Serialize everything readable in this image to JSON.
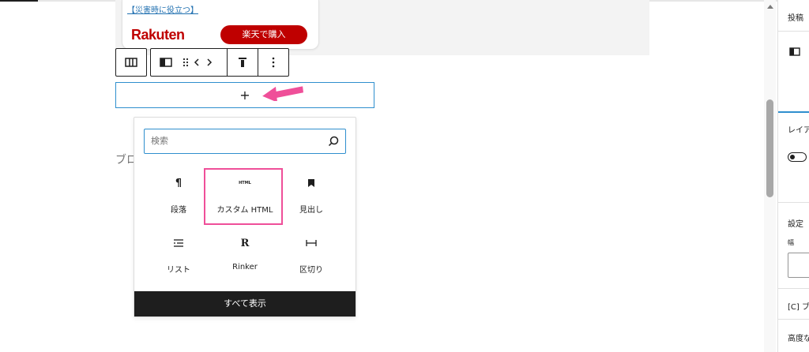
{
  "product_card": {
    "link_text": "【災害時に役立つ】",
    "logo_text": "Rakuten",
    "buy_button": "楽天で購入"
  },
  "block_toolbar": {
    "icons": [
      "columns-icon",
      "column-icon",
      "drag-handle-icon",
      "move-left-icon",
      "move-right-icon",
      "vertical-align-top-icon",
      "more-options-icon"
    ]
  },
  "appender": {
    "label": "+"
  },
  "background_placeholder": "ブロ",
  "inserter": {
    "search": {
      "placeholder": "検索",
      "value": ""
    },
    "blocks": [
      {
        "label": "段落",
        "icon": "paragraph-icon",
        "glyph": "¶"
      },
      {
        "label": "カスタム HTML",
        "icon": "html-icon",
        "glyph": "HTML"
      },
      {
        "label": "見出し",
        "icon": "heading-bookmark-icon",
        "glyph": ""
      },
      {
        "label": "リスト",
        "icon": "list-icon",
        "glyph": ""
      },
      {
        "label": "Rinker",
        "icon": "rinker-icon",
        "glyph": "R"
      },
      {
        "label": "区切り",
        "icon": "separator-icon",
        "glyph": ""
      }
    ],
    "show_all": "すべて表示"
  },
  "sidebar": {
    "post_tab": "投稿",
    "layout_label": "レイア",
    "settings_label": "設定",
    "width_label": "幅",
    "extra_label": "[C] ブ",
    "height_label": "高度な"
  },
  "colors": {
    "accent": "#2f8fce",
    "highlight": "#ef4f99",
    "rakuten_red": "#bf0000",
    "dark": "#1e1e1e"
  }
}
